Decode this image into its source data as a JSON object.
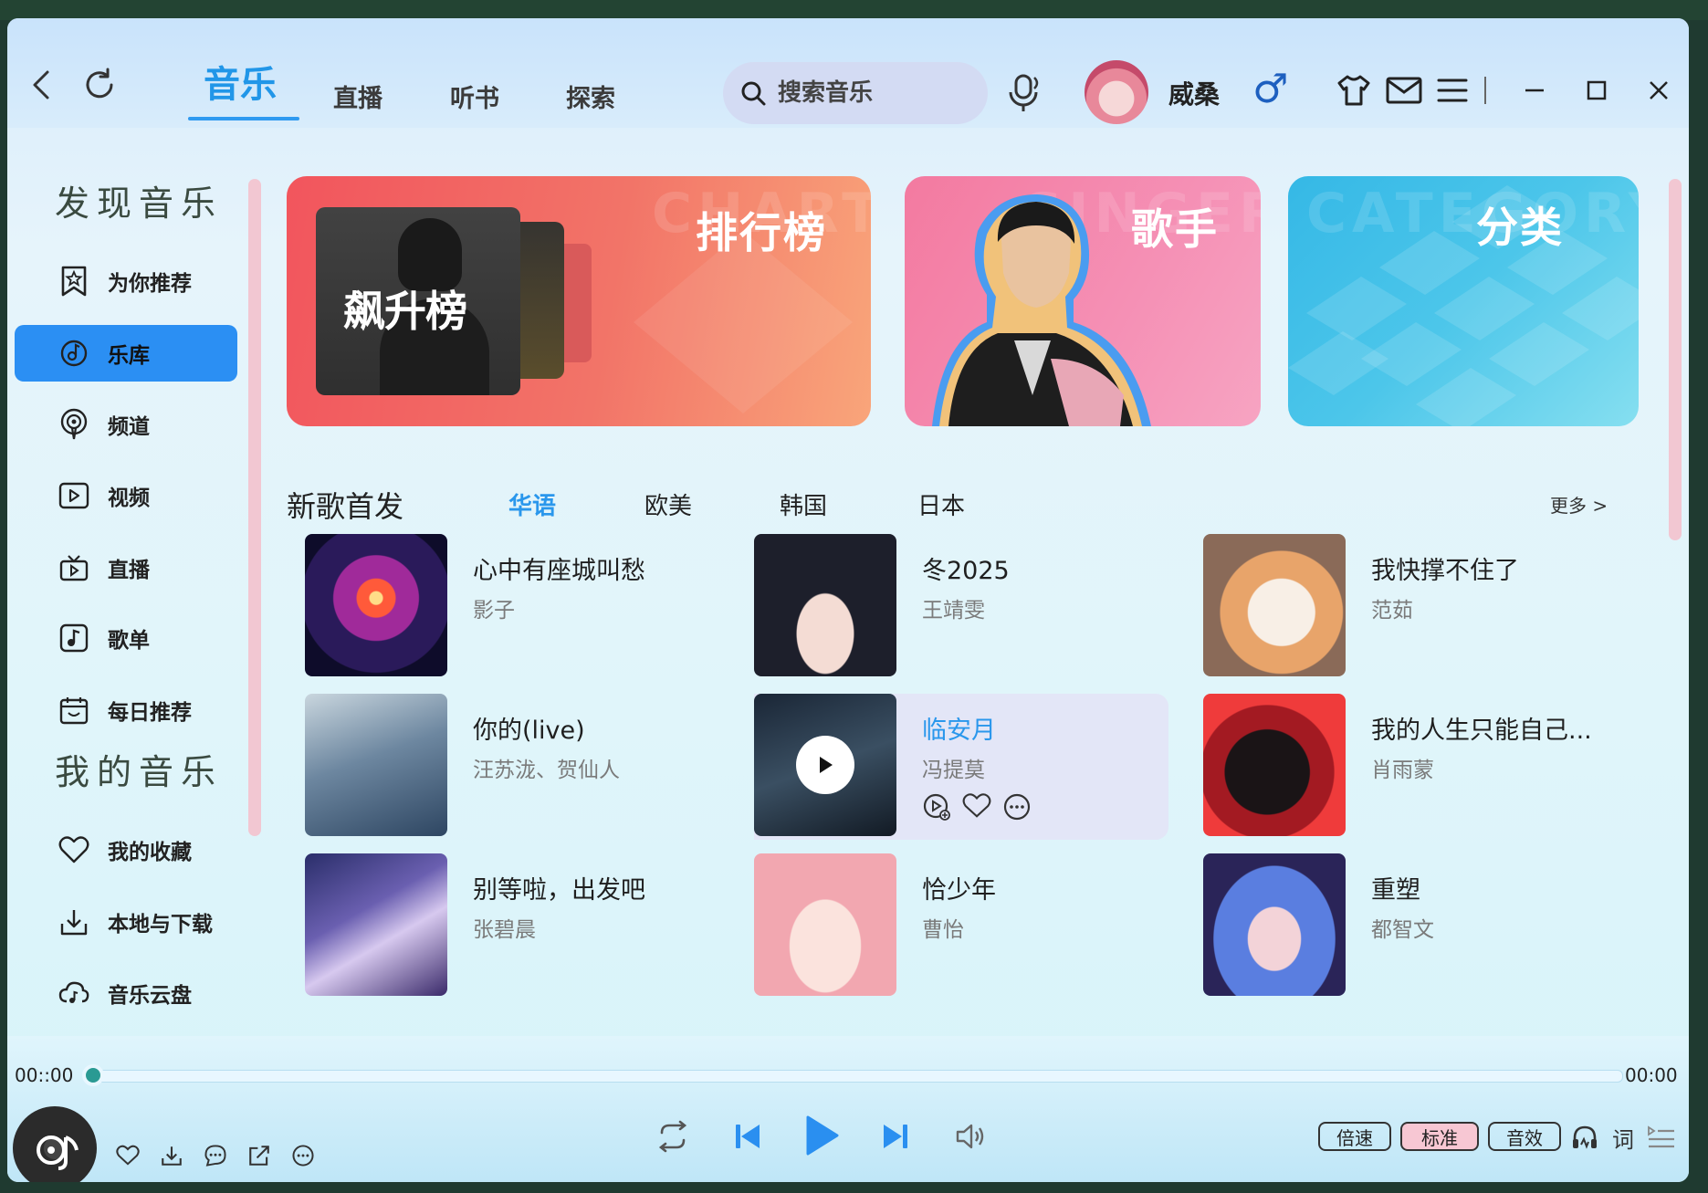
{
  "header": {
    "tabs": [
      {
        "label": "音乐",
        "active": true
      },
      {
        "label": "直播"
      },
      {
        "label": "听书"
      },
      {
        "label": "探索"
      }
    ],
    "search_placeholder": "搜索音乐",
    "username": "威桑",
    "gender_symbol": "♂"
  },
  "sidebar": {
    "discover_heading": "发现音乐",
    "mine_heading": "我的音乐",
    "discover_items": [
      {
        "label": "为你推荐",
        "icon": "star-bookmark-icon"
      },
      {
        "label": "乐库",
        "icon": "music-disc-icon",
        "active": true
      },
      {
        "label": "频道",
        "icon": "podcast-icon"
      },
      {
        "label": "视频",
        "icon": "video-icon"
      },
      {
        "label": "直播",
        "icon": "tv-live-icon"
      },
      {
        "label": "歌单",
        "icon": "playlist-icon"
      },
      {
        "label": "每日推荐",
        "icon": "calendar-icon"
      }
    ],
    "mine_items": [
      {
        "label": "我的收藏",
        "icon": "heart-icon"
      },
      {
        "label": "本地与下载",
        "icon": "download-icon"
      },
      {
        "label": "音乐云盘",
        "icon": "cloud-music-icon"
      }
    ]
  },
  "banners": [
    {
      "title": "排行榜",
      "watermark": "CHART",
      "inner_label": "飙升榜"
    },
    {
      "title": "歌手",
      "watermark": "SINGER"
    },
    {
      "title": "分类",
      "watermark": "CATEGORY"
    }
  ],
  "new_songs": {
    "title": "新歌首发",
    "tabs": [
      "华语",
      "欧美",
      "韩国",
      "日本"
    ],
    "active_tab": "华语",
    "more_label": "更多 >",
    "songs": [
      {
        "title": "心中有座城叫愁",
        "artist": "影子"
      },
      {
        "title": "冬2025",
        "artist": "王靖雯"
      },
      {
        "title": "我快撑不住了",
        "artist": "范茹"
      },
      {
        "title": "你的(live)",
        "artist": "汪苏泷、贺仙人"
      },
      {
        "title": "临安月",
        "artist": "冯提莫"
      },
      {
        "title": "我的人生只能自己...",
        "artist": "肖雨蒙"
      },
      {
        "title": "别等啦，出发吧",
        "artist": "张碧晨"
      },
      {
        "title": "恰少年",
        "artist": "曹怡"
      },
      {
        "title": "重塑",
        "artist": "都智文"
      }
    ]
  },
  "player": {
    "current_time": "00::00",
    "total_time": "00:00",
    "progress": 0,
    "speed_label": "倍速",
    "quality_label": "标准",
    "effect_label": "音效",
    "lyrics_label": "词"
  },
  "colors": {
    "accent": "#2b8ff3",
    "active_text": "#2a97ec",
    "scrollbar": "#f2c7d2"
  }
}
